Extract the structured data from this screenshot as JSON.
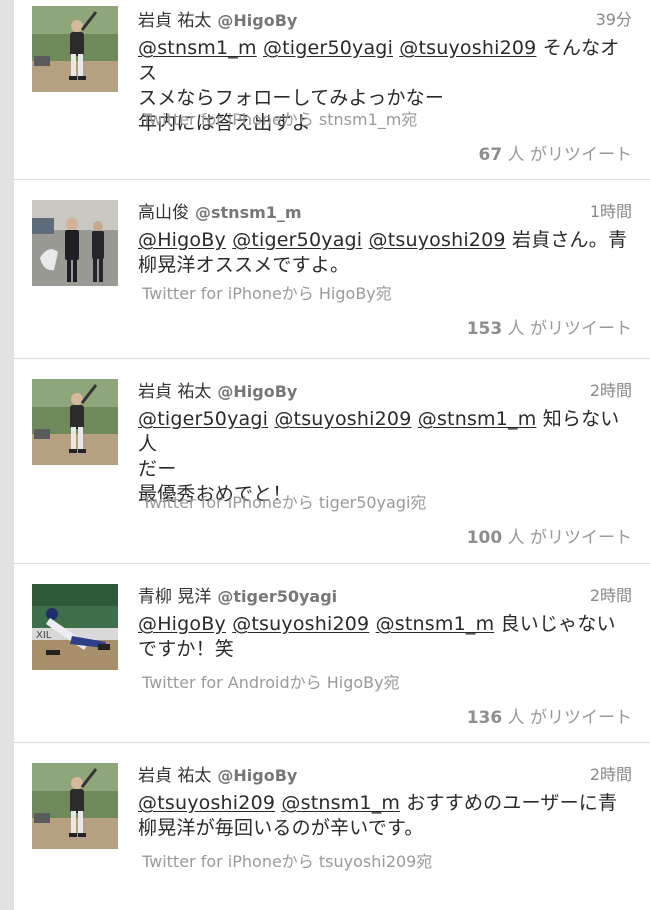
{
  "tweets": [
    {
      "name": "岩貞 祐太",
      "handle": "@HigoBy",
      "time": "39分",
      "mentions": [
        "@stnsm1_m",
        "@tiger50yagi",
        "@tsuyoshi209"
      ],
      "text_lines": [
        "そんなオス",
        "スメならフォローしてみよっかなー",
        "年内には答え出すよ"
      ],
      "source": "Twitter for iPhoneから stnsm1_m宛",
      "retweet_count": "67",
      "retweet_suffix": "人 がリツイート",
      "avatar_icon": "baseball-batter-avatar"
    },
    {
      "name": "高山俊",
      "handle": "@stnsm1_m",
      "time": "1時間",
      "mentions": [
        "@HigoBy",
        "@tiger50yagi",
        "@tsuyoshi209"
      ],
      "text_lines": [
        "岩貞さん。青",
        "柳晃洋オススメですよ。"
      ],
      "source": "Twitter for iPhoneから HigoBy宛",
      "retweet_count": "153",
      "retweet_suffix": "人 がリツイート",
      "avatar_icon": "men-in-suits-avatar"
    },
    {
      "name": "岩貞 祐太",
      "handle": "@HigoBy",
      "time": "2時間",
      "mentions": [
        "@tiger50yagi",
        "@tsuyoshi209",
        "@stnsm1_m"
      ],
      "text_lines": [
        "知らない人",
        "だー",
        "最優秀おめでと！"
      ],
      "source": "Twitter for iPhoneから tiger50yagi宛",
      "retweet_count": "100",
      "retweet_suffix": "人 がリツイート",
      "avatar_icon": "baseball-batter-avatar"
    },
    {
      "name": "青柳 晃洋",
      "handle": "@tiger50yagi",
      "time": "2時間",
      "mentions": [
        "@HigoBy",
        "@tsuyoshi209",
        "@stnsm1_m"
      ],
      "text_lines": [
        "良いじゃない",
        "ですか！笑"
      ],
      "source": "Twitter for Androidから HigoBy宛",
      "retweet_count": "136",
      "retweet_suffix": "人 がリツイート",
      "avatar_icon": "baseball-pitcher-avatar"
    },
    {
      "name": "岩貞 祐太",
      "handle": "@HigoBy",
      "time": "2時間",
      "mentions": [
        "@tsuyoshi209",
        "@stnsm1_m"
      ],
      "text_lines": [
        "おすすめのユーザーに青",
        "柳晃洋が毎回いるのが辛いです。"
      ],
      "source": "Twitter for iPhoneから tsuyoshi209宛",
      "retweet_count": "",
      "retweet_suffix": "",
      "avatar_icon": "baseball-batter-avatar"
    }
  ]
}
